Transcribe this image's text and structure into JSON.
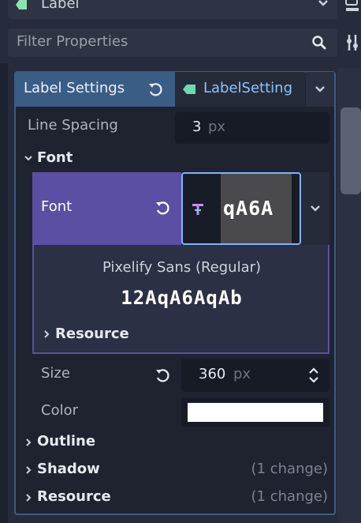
{
  "top": {
    "node_type": "Label"
  },
  "filter": {
    "placeholder": "Filter Properties"
  },
  "tabs": {
    "active_label": "Label Settings",
    "resource_label": "LabelSetting"
  },
  "line_spacing": {
    "label": "Line Spacing",
    "value": "3",
    "unit": "px"
  },
  "font_section": {
    "label": "Font"
  },
  "font_prop": {
    "label": "Font",
    "preview_text": "qA6A"
  },
  "font_info": {
    "name": "Pixelify Sans (Regular)",
    "sample": "12AqA6AqAb",
    "resource_label": "Resource"
  },
  "size": {
    "label": "Size",
    "value": "360",
    "unit": "px"
  },
  "color": {
    "label": "Color",
    "value": "#ffffff"
  },
  "sections": [
    {
      "label": "Outline",
      "change": ""
    },
    {
      "label": "Shadow",
      "change": "(1 change)"
    },
    {
      "label": "Resource",
      "change": "(1 change)"
    }
  ],
  "colors": {
    "accent": "#5a4fa2",
    "panel": "#1f2330",
    "tab_active": "#3a5d85"
  }
}
